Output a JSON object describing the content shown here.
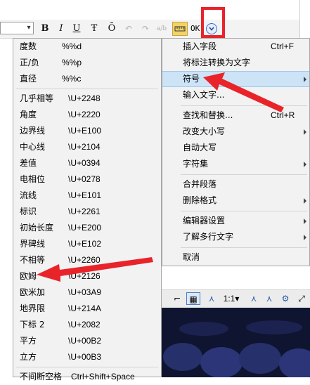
{
  "toolbar": {
    "buttons": [
      {
        "name": "bold-button",
        "icon": "B"
      },
      {
        "name": "italic-button",
        "icon": "I"
      },
      {
        "name": "underline-button",
        "icon": "U"
      },
      {
        "name": "strikethrough-button",
        "icon": "Ŧ"
      },
      {
        "name": "overline-button",
        "icon": "Ō"
      },
      {
        "name": "undo-button",
        "icon": "↶"
      },
      {
        "name": "redo-button",
        "icon": "↷"
      },
      {
        "name": "stack-button",
        "icon": "a/b"
      },
      {
        "name": "ruler-button",
        "icon": "▭"
      }
    ],
    "ok_label": "OK",
    "dropdown_icon": "chevron-down-icon"
  },
  "symbol_menu": {
    "items": [
      {
        "label": "度数",
        "code": "%%d"
      },
      {
        "label": "正/负",
        "code": "%%p"
      },
      {
        "label": "直径",
        "code": "%%c"
      },
      {
        "label": "几乎相等",
        "code": "\\U+2248"
      },
      {
        "label": "角度",
        "code": "\\U+2220"
      },
      {
        "label": "边界线",
        "code": "\\U+E100"
      },
      {
        "label": "中心线",
        "code": "\\U+2104"
      },
      {
        "label": "差值",
        "code": "\\U+0394"
      },
      {
        "label": "电相位",
        "code": "\\U+0278"
      },
      {
        "label": "流线",
        "code": "\\U+E101"
      },
      {
        "label": "标识",
        "code": "\\U+2261"
      },
      {
        "label": "初始长度",
        "code": "\\U+E200"
      },
      {
        "label": "界碑线",
        "code": "\\U+E102"
      },
      {
        "label": "不相等",
        "code": "\\U+2260"
      },
      {
        "label": "欧姆",
        "code": "\\U+2126"
      },
      {
        "label": "欧米加",
        "code": "\\U+03A9"
      },
      {
        "label": "地界限",
        "code": "\\U+214A"
      },
      {
        "label": "下标 2",
        "code": "\\U+2082"
      },
      {
        "label": "平方",
        "code": "\\U+00B2"
      },
      {
        "label": "立方",
        "code": "\\U+00B3"
      },
      {
        "label": "不间断空格",
        "code": "Ctrl+Shift+Space"
      }
    ]
  },
  "context_menu": {
    "items": [
      {
        "label": "插入字段",
        "shortcut": "Ctrl+F",
        "submenu": false
      },
      {
        "label": "将标注转换为文字",
        "shortcut": "",
        "submenu": false
      },
      {
        "label": "符号",
        "shortcut": "",
        "submenu": true,
        "highlight": true
      },
      {
        "label": "输入文字...",
        "shortcut": "",
        "submenu": false
      },
      {
        "label": "查找和替换...",
        "shortcut": "Ctrl+R",
        "submenu": false
      },
      {
        "label": "改变大小写",
        "shortcut": "",
        "submenu": true
      },
      {
        "label": "自动大写",
        "shortcut": "",
        "submenu": false
      },
      {
        "label": "字符集",
        "shortcut": "",
        "submenu": true
      },
      {
        "label": "合并段落",
        "shortcut": "",
        "submenu": false
      },
      {
        "label": "删除格式",
        "shortcut": "",
        "submenu": true
      },
      {
        "label": "编辑器设置",
        "shortcut": "",
        "submenu": true
      },
      {
        "label": "了解多行文字",
        "shortcut": "",
        "submenu": true
      },
      {
        "label": "取消",
        "shortcut": "",
        "submenu": false
      }
    ]
  },
  "bottom_toolbar": {
    "zoom_label": "1:1"
  },
  "colors": {
    "highlight": "#cde4f7",
    "annotation_red": "#e8242a",
    "menu_bg": "#f2f2f2"
  }
}
